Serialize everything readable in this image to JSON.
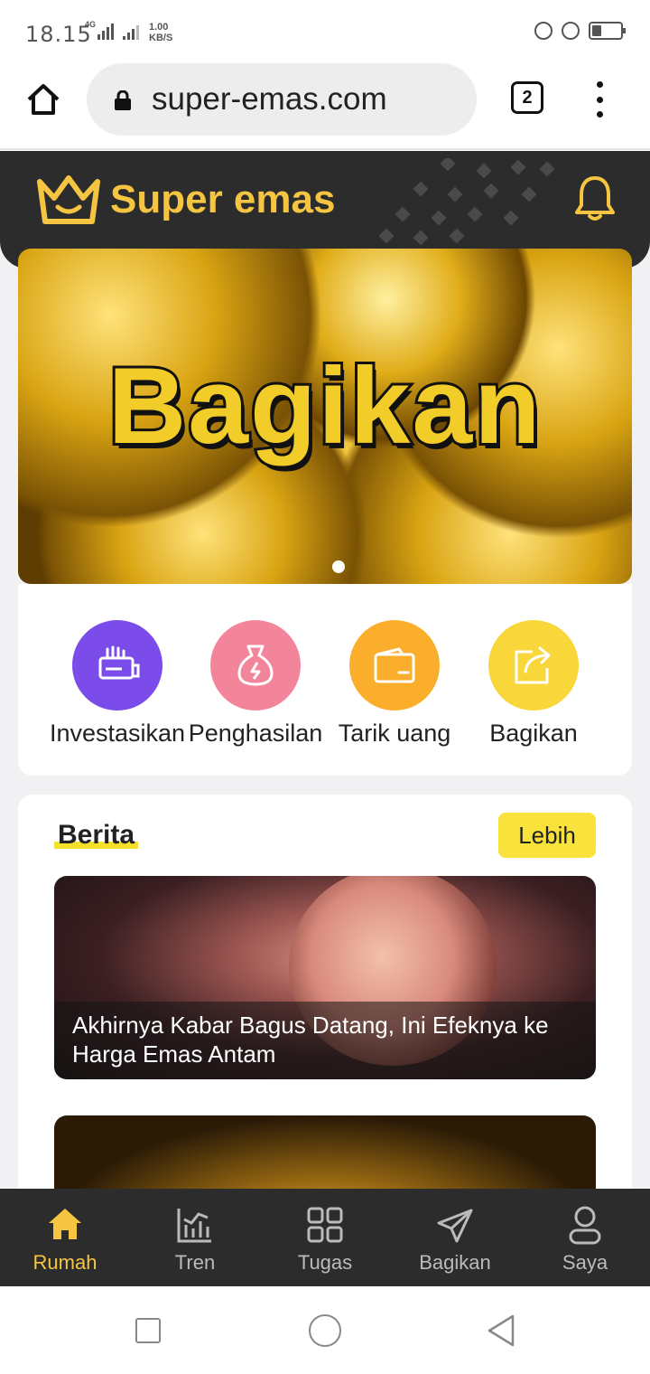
{
  "status_bar": {
    "time": "18.15",
    "network": "4G",
    "speed_value": "1.00",
    "speed_unit": "KB/S"
  },
  "browser": {
    "url": "super-emas.com",
    "tab_count": "2"
  },
  "header": {
    "brand": "Super emas",
    "brand_color": "#f5c542"
  },
  "banner": {
    "text": "Bagikan",
    "slide_count": 1,
    "active_slide": 1
  },
  "actions": [
    {
      "label": "Investasikan",
      "color": "#7b4cea",
      "icon": "card-hand-icon"
    },
    {
      "label": "Penghasilan",
      "color": "#f3859b",
      "icon": "money-bag-icon"
    },
    {
      "label": "Tarik uang",
      "color": "#fbad2c",
      "icon": "wallet-icon"
    },
    {
      "label": "Bagikan",
      "color": "#f9d63a",
      "icon": "share-icon"
    }
  ],
  "news": {
    "title": "Berita",
    "more_label": "Lebih",
    "items": [
      {
        "headline": "Akhirnya Kabar Bagus Datang, Ini Efeknya ke Harga Emas Antam"
      }
    ]
  },
  "bottom_nav": [
    {
      "label": "Rumah",
      "icon": "home-icon",
      "active": true
    },
    {
      "label": "Tren",
      "icon": "chart-icon",
      "active": false
    },
    {
      "label": "Tugas",
      "icon": "grid-icon",
      "active": false
    },
    {
      "label": "Bagikan",
      "icon": "send-icon",
      "active": false
    },
    {
      "label": "Saya",
      "icon": "user-icon",
      "active": false
    }
  ],
  "accent_color": "#f5c542"
}
